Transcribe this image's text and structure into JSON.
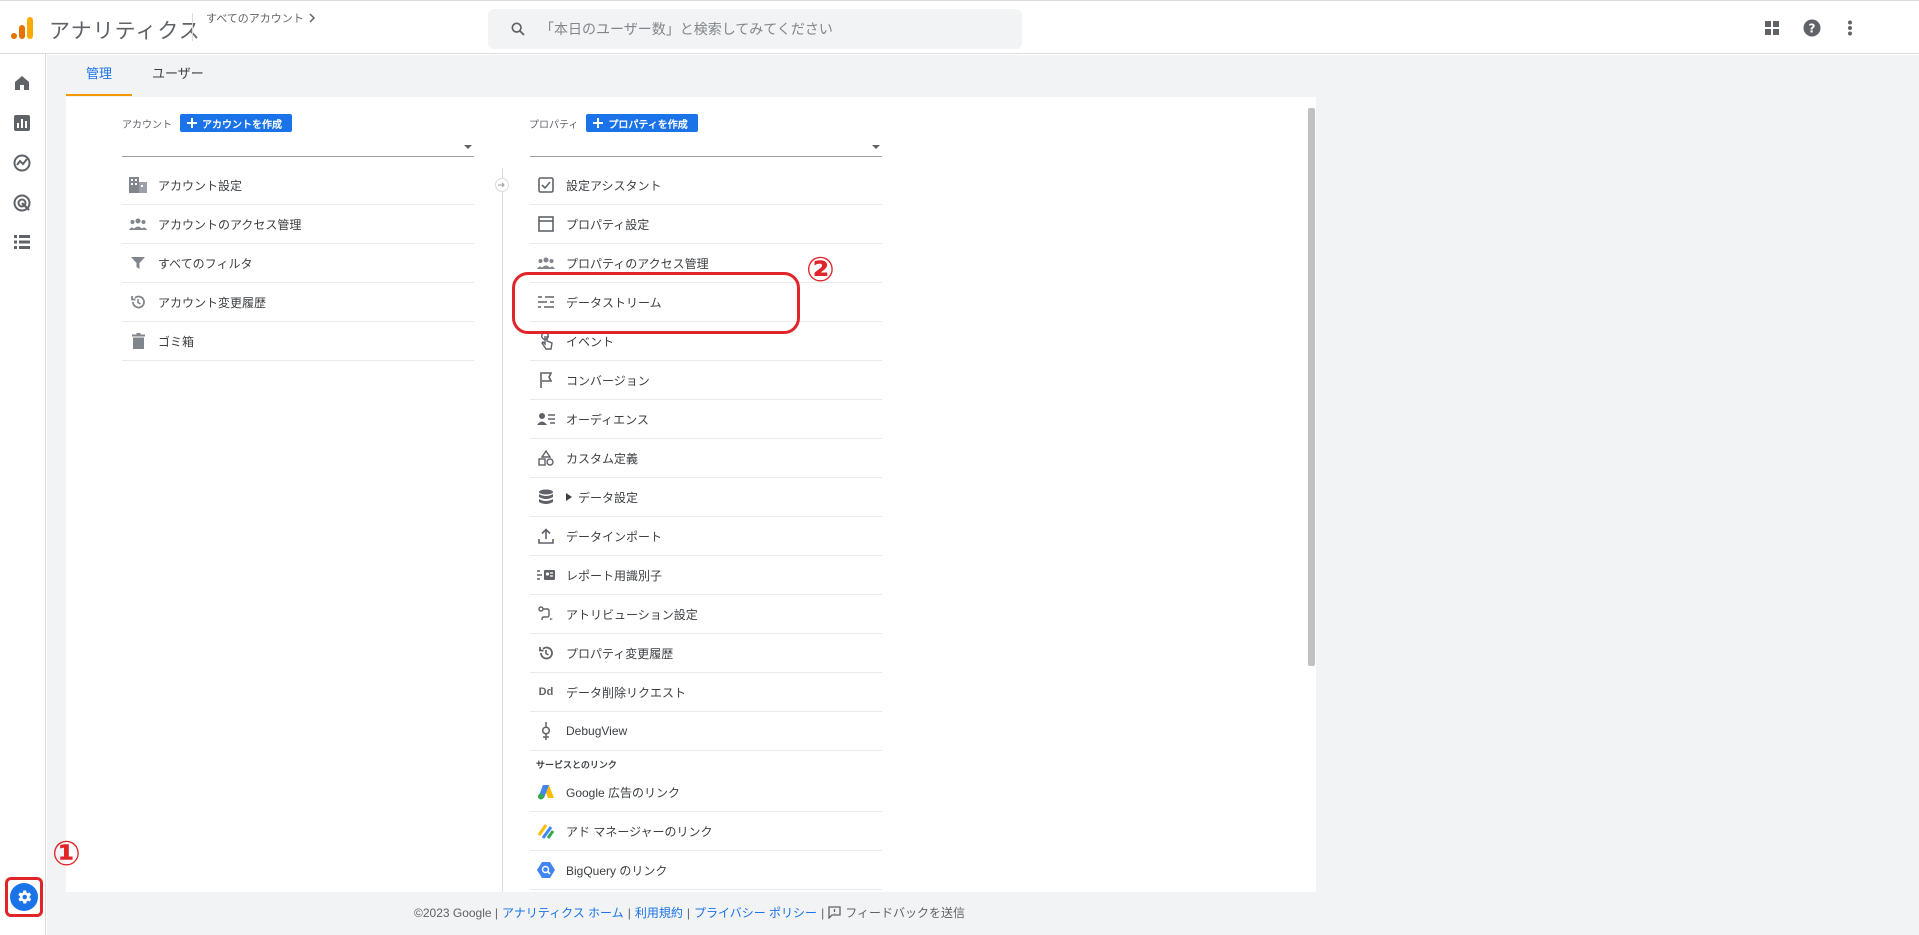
{
  "header": {
    "app_title": "アナリティクス",
    "account_crumb": "すべてのアカウント",
    "search_placeholder": "「本日のユーザー数」と検索してみてください"
  },
  "tabs": [
    {
      "label": "管理",
      "active": true
    },
    {
      "label": "ユーザー",
      "active": false
    }
  ],
  "account_column": {
    "label": "アカウント",
    "create_button": "アカウントを作成",
    "items": [
      {
        "label": "アカウント設定",
        "icon": "building-icon"
      },
      {
        "label": "アカウントのアクセス管理",
        "icon": "people-icon"
      },
      {
        "label": "すべてのフィルタ",
        "icon": "filter-icon"
      },
      {
        "label": "アカウント変更履歴",
        "icon": "history-icon"
      },
      {
        "label": "ゴミ箱",
        "icon": "trash-icon"
      }
    ]
  },
  "property_column": {
    "label": "プロパティ",
    "create_button": "プロパティを作成",
    "items": [
      {
        "label": "設定アシスタント",
        "icon": "checkbox-icon"
      },
      {
        "label": "プロパティ設定",
        "icon": "window-icon"
      },
      {
        "label": "プロパティのアクセス管理",
        "icon": "people-icon"
      },
      {
        "label": "データストリーム",
        "icon": "stream-icon"
      },
      {
        "label": "イベント",
        "icon": "touch-icon"
      },
      {
        "label": "コンバージョン",
        "icon": "flag-icon"
      },
      {
        "label": "オーディエンス",
        "icon": "audience-icon"
      },
      {
        "label": "カスタム定義",
        "icon": "shapes-icon"
      },
      {
        "label": "データ設定",
        "icon": "database-icon"
      },
      {
        "label": "データインポート",
        "icon": "upload-icon"
      },
      {
        "label": "レポート用識別子",
        "icon": "identifier-icon"
      },
      {
        "label": "アトリビューション設定",
        "icon": "attribution-icon"
      },
      {
        "label": "プロパティ変更履歴",
        "icon": "history-icon"
      },
      {
        "label": "データ削除リクエスト",
        "icon": "dd-icon"
      },
      {
        "label": "DebugView",
        "icon": "debug-icon"
      }
    ],
    "dd_glyph": "Dd",
    "section_links": "サービスとのリンク",
    "links": [
      {
        "label": "Google 広告のリンク",
        "icon": "google-ads-icon"
      },
      {
        "label": "アド マネージャーのリンク",
        "icon": "ad-manager-icon"
      },
      {
        "label": "BigQuery のリンク",
        "icon": "bigquery-icon"
      }
    ]
  },
  "annotations": {
    "one": "①",
    "two": "②"
  },
  "footer": {
    "copyright": "©2023 Google |",
    "home_link": "アナリティクス ホーム",
    "sep1": "|",
    "terms_link": "利用規約",
    "sep2": "|",
    "privacy_link": "プライバシー ポリシー",
    "sep3": "|",
    "feedback": "フィードバックを送信"
  },
  "colors": {
    "accent": "#1a73e8",
    "tab_underline": "#f29900",
    "annotation": "#e0252a"
  }
}
